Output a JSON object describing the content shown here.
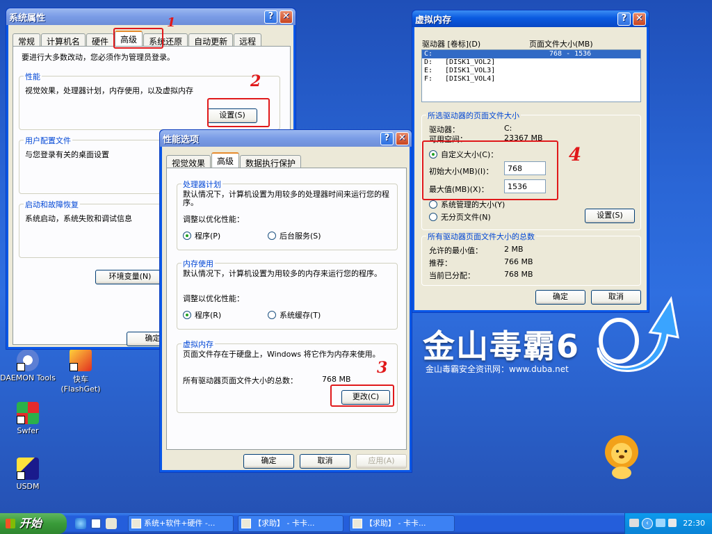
{
  "desktop": {
    "brand_title": "金山毒霸6",
    "brand_sub": "金山毒霸安全资讯网：www.duba.net",
    "icons": [
      {
        "label": "DAEMON Tools"
      },
      {
        "label": "快车\n(FlashGet)"
      },
      {
        "label": "Swfer"
      },
      {
        "label": "USDM"
      }
    ]
  },
  "sysprops": {
    "title": "系统属性",
    "tabs": [
      "常规",
      "计算机名",
      "硬件",
      "高级",
      "系统还原",
      "自动更新",
      "远程"
    ],
    "admin_note": "要进行大多数改动，您必须作为管理员登录。",
    "perf_title": "性能",
    "perf_desc": "视觉效果，处理器计划，内存使用，以及虚拟内存",
    "perf_btn": "设置(S)",
    "profile_title": "用户配置文件",
    "profile_desc": "与您登录有关的桌面设置",
    "startup_title": "启动和故障恢复",
    "startup_desc": "系统启动，系统失败和调试信息",
    "env_btn": "环境变量(N)",
    "ok_btn": "确定"
  },
  "perfopts": {
    "title": "性能选项",
    "tabs": [
      "视觉效果",
      "高级",
      "数据执行保护"
    ],
    "cpu_title": "处理器计划",
    "cpu_desc": "默认情况下，计算机设置为用较多的处理器时间来运行您的程序。",
    "cpu_adjust": "调整以优化性能：",
    "cpu_opt1": "程序(P)",
    "cpu_opt2": "后台服务(S)",
    "mem_title": "内存使用",
    "mem_desc": "默认情况下，计算机设置为用较多的内存来运行您的程序。",
    "mem_adjust": "调整以优化性能：",
    "mem_opt1": "程序(R)",
    "mem_opt2": "系统缓存(T)",
    "vm_title": "虚拟内存",
    "vm_desc": "页面文件存在于硬盘上，Windows 将它作为内存来使用。",
    "vm_total_label": "所有驱动器页面文件大小的总数：",
    "vm_total_value": "768 MB",
    "change_btn": "更改(C)",
    "ok_btn": "确定",
    "cancel_btn": "取消",
    "apply_btn": "应用(A)"
  },
  "vmem": {
    "title": "虚拟内存",
    "col_drive": "驱动器 [卷标](D)",
    "col_size": "页面文件大小(MB)",
    "drives": [
      {
        "drive": "C:",
        "label": "",
        "size": "768 - 1536"
      },
      {
        "drive": "D:",
        "label": "[DISK1_VOL2]",
        "size": ""
      },
      {
        "drive": "E:",
        "label": "[DISK1_VOL3]",
        "size": ""
      },
      {
        "drive": "F:",
        "label": "[DISK1_VOL4]",
        "size": ""
      }
    ],
    "sel_title": "所选驱动器的页面文件大小",
    "drive_label": "驱动器：",
    "drive_value": "C:",
    "free_label": "可用空间：",
    "free_value": "23367 MB",
    "custom": "自定义大小(C)：",
    "initial_label": "初始大小(MB)(I)：",
    "initial_value": "768",
    "max_label": "最大值(MB)(X)：",
    "max_value": "1536",
    "sys_managed": "系统管理的大小(Y)",
    "no_paging": "无分页文件(N)",
    "set_btn": "设置(S)",
    "total_title": "所有驱动器页面文件大小的总数",
    "min_label": "允许的最小值：",
    "min_value": "2 MB",
    "rec_label": "推荐：",
    "rec_value": "766 MB",
    "cur_label": "当前已分配：",
    "cur_value": "768 MB",
    "ok_btn": "确定",
    "cancel_btn": "取消"
  },
  "annotations": {
    "n1": "1",
    "n2": "2",
    "n3": "3",
    "n4": "4"
  },
  "taskbar": {
    "start": "开始",
    "tasks": [
      "系统+软件+硬件 -...",
      "【求助】 - 卡卡...",
      "【求助】 - 卡卡..."
    ],
    "clock": "22:30"
  }
}
